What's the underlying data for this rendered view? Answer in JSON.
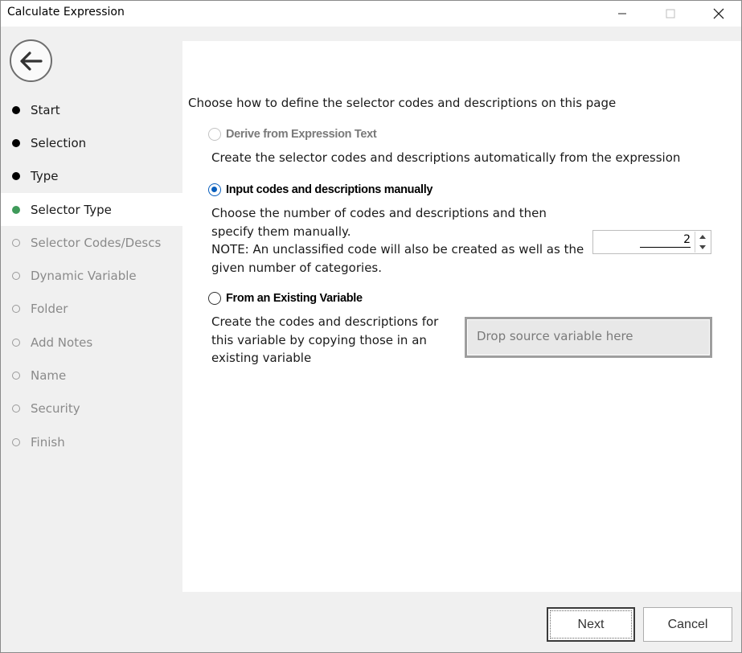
{
  "window": {
    "title": "Calculate Expression"
  },
  "sidebar": {
    "steps": [
      {
        "label": "Start",
        "state": "done"
      },
      {
        "label": "Selection",
        "state": "done"
      },
      {
        "label": "Type",
        "state": "done"
      },
      {
        "label": "Selector Type",
        "state": "current"
      },
      {
        "label": "Selector Codes/Descs",
        "state": "todo"
      },
      {
        "label": "Dynamic Variable",
        "state": "todo"
      },
      {
        "label": "Folder",
        "state": "todo"
      },
      {
        "label": "Add Notes",
        "state": "todo"
      },
      {
        "label": "Name",
        "state": "todo"
      },
      {
        "label": "Security",
        "state": "todo"
      },
      {
        "label": "Finish",
        "state": "todo"
      }
    ]
  },
  "main": {
    "intro": "Choose how to define the selector codes and descriptions on this page",
    "options": [
      {
        "label": "Derive from Expression Text",
        "state": "disabled",
        "description": [
          "Create the selector codes and descriptions automatically from the expression"
        ]
      },
      {
        "label": "Input codes and descriptions manually",
        "state": "checked",
        "description": [
          "Choose the number of codes and descriptions and then",
          "specify  them  manually.",
          "NOTE: An unclassified code will also be created as well as the",
          "given number of categories."
        ]
      },
      {
        "label": "From an Existing Variable",
        "state": "unchecked",
        "description": [
          "Create the codes and descriptions for",
          "this variable by copying those in an",
          "existing variable"
        ]
      }
    ],
    "code_count": "2",
    "dropzone_placeholder": "Drop source variable here"
  },
  "footer": {
    "next_label": "Next",
    "cancel_label": "Cancel"
  },
  "colors": {
    "current_step": "#3f9a5a",
    "radio_checked": "#0a5fbd"
  }
}
